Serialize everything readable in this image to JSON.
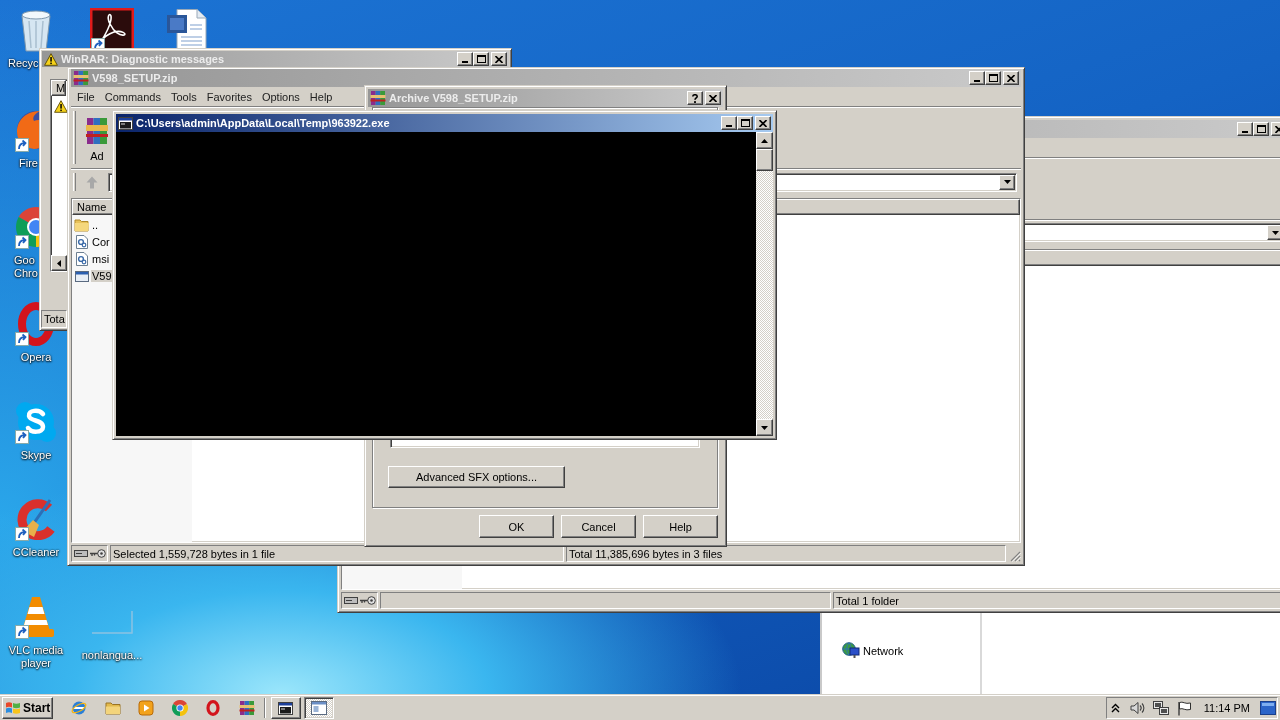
{
  "desktop_icons": [
    {
      "kind": "recycle-bin",
      "label": "Recyc",
      "shortcut": false
    },
    {
      "kind": "pdf-reader",
      "shortcut": true
    },
    {
      "kind": "word-document",
      "shortcut": false
    },
    {
      "kind": "firefox",
      "label": "Fire",
      "shortcut": true
    },
    {
      "kind": "chrome",
      "label": "Goo\nChro",
      "shortcut": true
    },
    {
      "kind": "opera",
      "label": "Opera",
      "shortcut": true
    },
    {
      "kind": "skype",
      "label": "Skype",
      "shortcut": true
    },
    {
      "kind": "ccleaner",
      "label": "CCleaner",
      "shortcut": true
    },
    {
      "kind": "vlc",
      "label": "VLC media player",
      "shortcut": true
    },
    {
      "kind": "blank-file",
      "label": "nonlangua...",
      "shortcut": false
    }
  ],
  "explorer_window": {
    "navigation": [
      {
        "kind": "network",
        "label": "Network"
      }
    ]
  },
  "archiver_window_back": {
    "active": false,
    "status_total": "Total 1 folder"
  },
  "diagnostic_window": {
    "title": "WinRAR: Diagnostic messages",
    "active": false,
    "column": "M",
    "messages": [
      {
        "kind": "warning"
      }
    ],
    "status": "Tota"
  },
  "archiver_window": {
    "title": "V598_SETUP.zip",
    "active": false,
    "menu": [
      "File",
      "Commands",
      "Tools",
      "Favorites",
      "Options",
      "Help"
    ],
    "toolbar": [
      {
        "kind": "add",
        "label": "Ad"
      }
    ],
    "columns": [
      "Name"
    ],
    "files": [
      {
        "kind": "folder",
        "name": "..",
        "selected": false
      },
      {
        "kind": "file",
        "name": "Cor",
        "selected": false
      },
      {
        "kind": "file",
        "name": "msi",
        "selected": false
      },
      {
        "kind": "executable",
        "name": "V59",
        "selected": true
      }
    ],
    "status_selection": "Selected 1,559,728 bytes in 1 file",
    "status_total": "Total 11,385,696 bytes in 3 files"
  },
  "archive_dialog": {
    "title": "Archive V598_SETUP.zip",
    "active": false,
    "advanced_button": "Advanced SFX options...",
    "buttons": [
      "OK",
      "Cancel",
      "Help"
    ]
  },
  "console_window": {
    "title": "C:\\Users\\admin\\AppData\\Local\\Temp\\963922.exe",
    "active": true
  },
  "taskbar": {
    "start": "Start",
    "quick_launch": [
      {
        "kind": "ie"
      },
      {
        "kind": "explorer"
      },
      {
        "kind": "media-player"
      },
      {
        "kind": "chrome"
      },
      {
        "kind": "opera"
      },
      {
        "kind": "winrar"
      }
    ],
    "tasks": [
      {
        "kind": "program",
        "selected": false
      },
      {
        "kind": "window",
        "selected": true
      }
    ],
    "clock": "11:14 PM"
  }
}
